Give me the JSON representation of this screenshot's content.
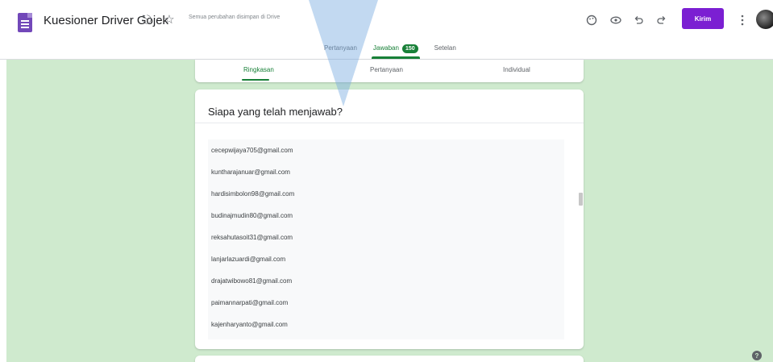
{
  "header": {
    "title": "Kuesioner Driver Gojek",
    "save_status": "Semua perubahan disimpan di Drive",
    "send_label": "Kirim",
    "icons": {
      "app": "forms-logo-icon",
      "move": "move-to-folder-icon",
      "star": "star-icon",
      "palette": "palette-icon",
      "preview": "eye-icon",
      "undo": "undo-icon",
      "redo": "redo-icon",
      "more": "more-vert-icon"
    }
  },
  "tabs": {
    "questions": "Pertanyaan",
    "responses": "Jawaban",
    "responses_count": "150",
    "settings": "Setelan"
  },
  "subtabs": {
    "summary": "Ringkasan",
    "question": "Pertanyaan",
    "individual": "Individual"
  },
  "card": {
    "title": "Siapa yang telah menjawab?"
  },
  "respondents": [
    "cecepwijaya705@gmail.com",
    "kuntharajanuar@gmail.com",
    "hardisimbolon98@gmail.com",
    "budinajmudin80@gmail.com",
    "reksahutasoit31@gmail.com",
    "lanjarlazuardi@gmail.com",
    "drajatwibowo81@gmail.com",
    "paimannarpati@gmail.com",
    "kajenharyanto@gmail.com"
  ],
  "colors": {
    "accent_green": "#188038",
    "send_purple": "#7b1fd2",
    "background_green": "#cfeace"
  }
}
